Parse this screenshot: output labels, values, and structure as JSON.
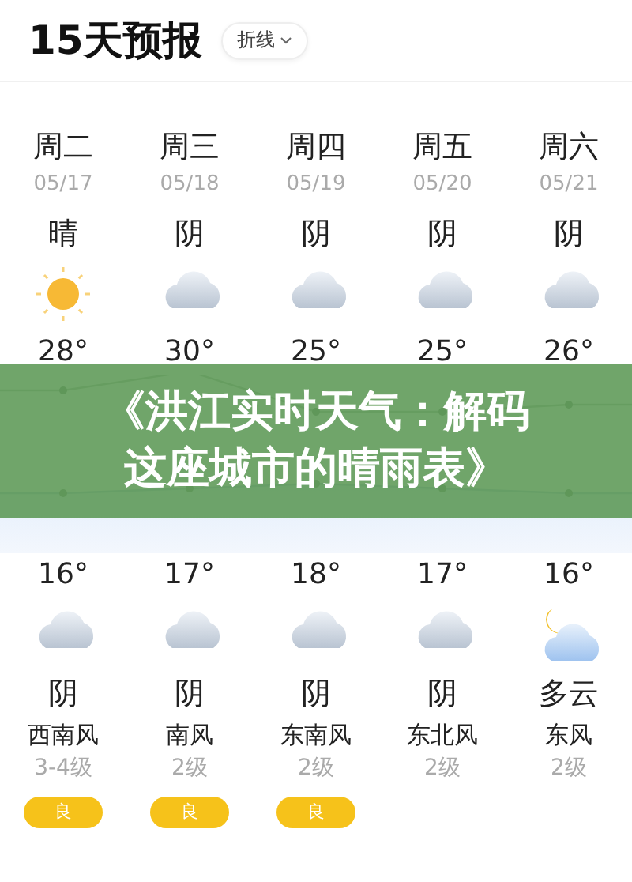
{
  "header": {
    "title": "15天预报",
    "view_switch": {
      "label": "折线",
      "expanded": false
    }
  },
  "days": [
    {
      "weekday": "周二",
      "date": "05/17",
      "day_weather": "晴",
      "day_icon": {
        "kind": "sun"
      },
      "high": "28°",
      "low": "16°",
      "night_icon": {
        "kind": "cloud"
      },
      "night_weather": "阴",
      "wind": "西南风",
      "wind_level": "3-4级",
      "aqi": {
        "label": "良",
        "color": "#f6c21a"
      }
    },
    {
      "weekday": "周三",
      "date": "05/18",
      "day_weather": "阴",
      "day_icon": {
        "kind": "cloud"
      },
      "high": "30°",
      "low": "17°",
      "night_icon": {
        "kind": "cloud"
      },
      "night_weather": "阴",
      "wind": "南风",
      "wind_level": "2级",
      "aqi": {
        "label": "良",
        "color": "#f6c21a"
      }
    },
    {
      "weekday": "周四",
      "date": "05/19",
      "day_weather": "阴",
      "day_icon": {
        "kind": "cloud"
      },
      "high": "25°",
      "low": "18°",
      "night_icon": {
        "kind": "cloud"
      },
      "night_weather": "阴",
      "wind": "东南风",
      "wind_level": "2级",
      "aqi": {
        "label": "良",
        "color": "#f6c21a"
      }
    },
    {
      "weekday": "周五",
      "date": "05/20",
      "day_weather": "阴",
      "day_icon": {
        "kind": "cloud"
      },
      "high": "25°",
      "low": "17°",
      "night_icon": {
        "kind": "cloud"
      },
      "night_weather": "阴",
      "wind": "东北风",
      "wind_level": "2级"
    },
    {
      "weekday": "周六",
      "date": "05/21",
      "day_weather": "阴",
      "day_icon": {
        "kind": "cloud"
      },
      "high": "26°",
      "low": "16°",
      "night_icon": {
        "kind": "moon_cloud"
      },
      "night_weather": "多云",
      "wind": "东风",
      "wind_level": "2级"
    }
  ],
  "banner": {
    "lines": [
      "《洪江实时天气：解码",
      "这座城市的晴雨表》"
    ]
  }
}
